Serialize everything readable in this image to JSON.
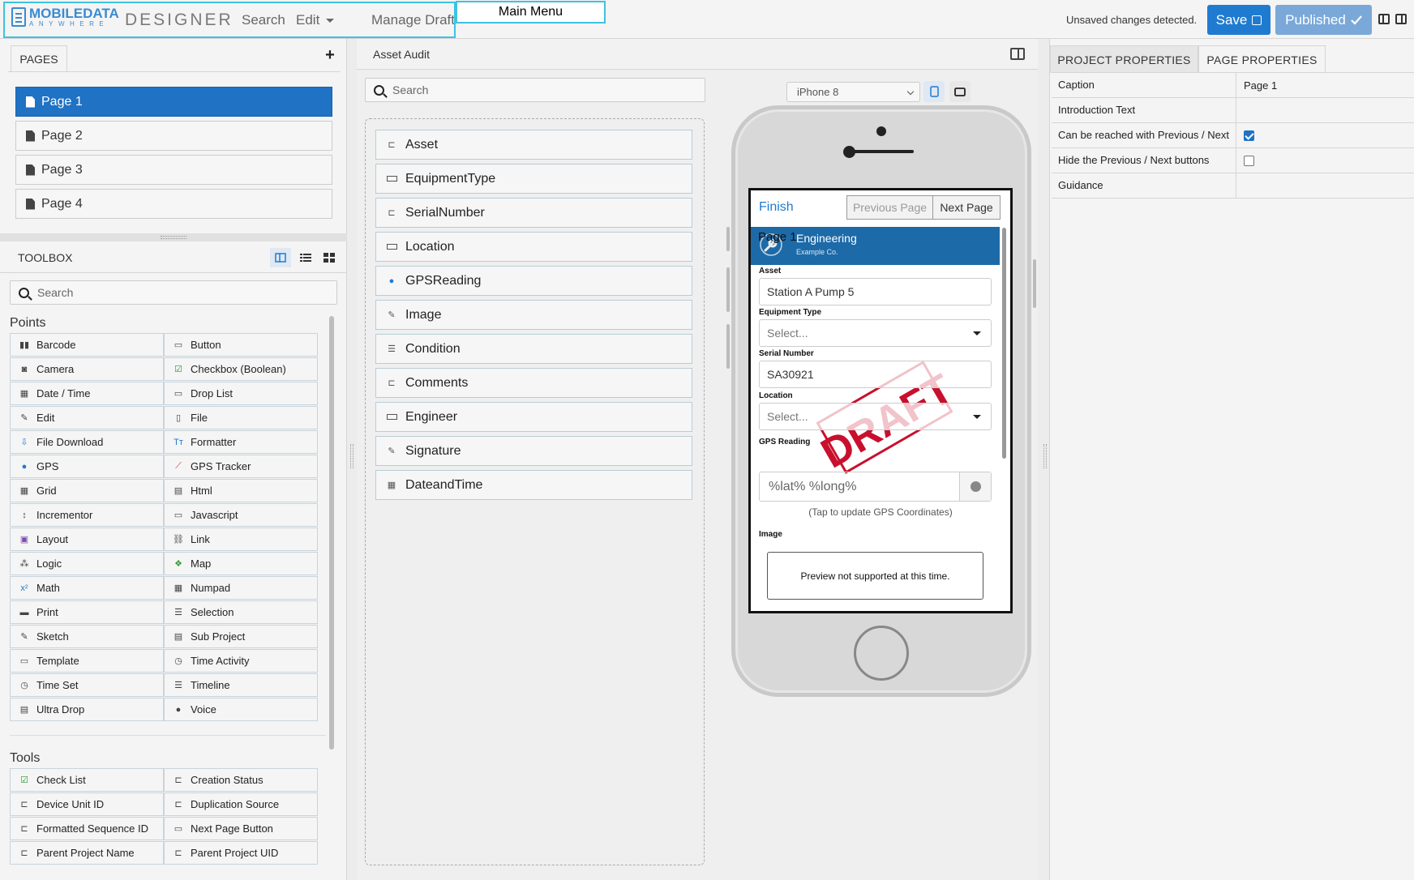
{
  "header": {
    "logo_top": "MOBILEDATA",
    "logo_bottom": "ANYWHERE",
    "app_name": "DESIGNER",
    "menu": [
      "Search",
      "Edit",
      "Manage Draft"
    ],
    "main_menu_label": "Main Menu",
    "status_text": "Unsaved changes detected.",
    "save_label": "Save",
    "published_label": "Published",
    "accent_color": "#1f7bd0"
  },
  "pages_panel": {
    "tab_label": "PAGES",
    "add_icon": "plus-icon",
    "items": [
      {
        "label": "Page 1",
        "active": true
      },
      {
        "label": "Page 2",
        "active": false
      },
      {
        "label": "Page 3",
        "active": false
      },
      {
        "label": "Page 4",
        "active": false
      }
    ]
  },
  "toolbox": {
    "title": "TOOLBOX",
    "search_placeholder": "Search",
    "points_label": "Points",
    "points": [
      {
        "label": "Barcode",
        "icon": "barcode-icon"
      },
      {
        "label": "Button",
        "icon": "button-icon"
      },
      {
        "label": "Camera",
        "icon": "camera-icon"
      },
      {
        "label": "Checkbox (Boolean)",
        "icon": "checkbox-icon"
      },
      {
        "label": "Date / Time",
        "icon": "calendar-icon"
      },
      {
        "label": "Drop List",
        "icon": "droplist-icon"
      },
      {
        "label": "Edit",
        "icon": "edit-icon"
      },
      {
        "label": "File",
        "icon": "file-icon"
      },
      {
        "label": "File Download",
        "icon": "file-download-icon"
      },
      {
        "label": "Formatter",
        "icon": "formatter-icon"
      },
      {
        "label": "GPS",
        "icon": "map-pin-icon"
      },
      {
        "label": "GPS Tracker",
        "icon": "gps-tracker-icon"
      },
      {
        "label": "Grid",
        "icon": "grid-icon"
      },
      {
        "label": "Html",
        "icon": "html-icon"
      },
      {
        "label": "Incrementor",
        "icon": "incrementor-icon"
      },
      {
        "label": "Javascript",
        "icon": "javascript-icon"
      },
      {
        "label": "Layout",
        "icon": "layout-icon"
      },
      {
        "label": "Link",
        "icon": "link-icon"
      },
      {
        "label": "Logic",
        "icon": "logic-icon"
      },
      {
        "label": "Map",
        "icon": "map-icon"
      },
      {
        "label": "Math",
        "icon": "math-icon"
      },
      {
        "label": "Numpad",
        "icon": "numpad-icon"
      },
      {
        "label": "Print",
        "icon": "print-icon"
      },
      {
        "label": "Selection",
        "icon": "selection-icon"
      },
      {
        "label": "Sketch",
        "icon": "sketch-icon"
      },
      {
        "label": "Sub Project",
        "icon": "sub-project-icon"
      },
      {
        "label": "Template",
        "icon": "template-icon"
      },
      {
        "label": "Time Activity",
        "icon": "time-activity-icon"
      },
      {
        "label": "Time Set",
        "icon": "clock-icon"
      },
      {
        "label": "Timeline",
        "icon": "timeline-icon"
      },
      {
        "label": "Ultra Drop",
        "icon": "ultra-drop-icon"
      },
      {
        "label": "Voice",
        "icon": "microphone-icon"
      }
    ],
    "tools_label": "Tools",
    "tools": [
      {
        "label": "Check List",
        "icon": "checklist-icon"
      },
      {
        "label": "Creation Status",
        "icon": "tag-icon"
      },
      {
        "label": "Device Unit ID",
        "icon": "tag-icon"
      },
      {
        "label": "Duplication Source",
        "icon": "tag-icon"
      },
      {
        "label": "Formatted Sequence ID",
        "icon": "tag-icon"
      },
      {
        "label": "Next Page Button",
        "icon": "button-icon"
      },
      {
        "label": "Parent Project Name",
        "icon": "tag-icon"
      },
      {
        "label": "Parent Project UID",
        "icon": "tag-icon"
      }
    ]
  },
  "canvas": {
    "title": "Asset Audit",
    "search_placeholder": "Search",
    "fields": [
      {
        "label": "Asset",
        "icon": "tag-icon"
      },
      {
        "label": "EquipmentType",
        "icon": "droplist-icon"
      },
      {
        "label": "SerialNumber",
        "icon": "tag-icon"
      },
      {
        "label": "Location",
        "icon": "droplist-icon"
      },
      {
        "label": "GPSReading",
        "icon": "map-pin-icon"
      },
      {
        "label": "Image",
        "icon": "sketch-icon"
      },
      {
        "label": "Condition",
        "icon": "selection-icon"
      },
      {
        "label": "Comments",
        "icon": "tag-icon"
      },
      {
        "label": "Engineer",
        "icon": "droplist-icon"
      },
      {
        "label": "Signature",
        "icon": "sketch-icon"
      },
      {
        "label": "DateandTime",
        "icon": "calendar-icon"
      }
    ]
  },
  "preview": {
    "device": "iPhone 8",
    "finish_label": "Finish",
    "prev_label": "Previous Page",
    "next_label": "Next Page",
    "banner_page": "Page 1",
    "banner_title": "Engineering",
    "banner_sub": "Example Co.",
    "banner_color": "#1d6aa8",
    "asset_label": "Asset",
    "asset_value": "Station A Pump 5",
    "equipment_label": "Equipment Type",
    "equipment_value": "Select...",
    "serial_label": "Serial Number",
    "serial_value": "SA30921",
    "location_label": "Location",
    "location_value": "Select...",
    "gps_label": "GPS Reading",
    "gps_value": "%lat% %long%",
    "gps_hint": "(Tap to update GPS Coordinates)",
    "image_label": "Image",
    "image_preview": "Preview not supported at this time.",
    "stamp_text": "DRAFT",
    "stamp_color": "#c8102e"
  },
  "properties": {
    "tabs": [
      "PROJECT PROPERTIES",
      "PAGE PROPERTIES"
    ],
    "rows": [
      {
        "label": "Caption",
        "value": "Page 1",
        "type": "text"
      },
      {
        "label": "Introduction Text",
        "value": "",
        "type": "text"
      },
      {
        "label": "Can be reached with Previous / Next",
        "value": "true",
        "type": "checkbox"
      },
      {
        "label": "Hide the Previous / Next buttons",
        "value": "false",
        "type": "checkbox"
      },
      {
        "label": "Guidance",
        "value": "",
        "type": "text"
      }
    ]
  }
}
